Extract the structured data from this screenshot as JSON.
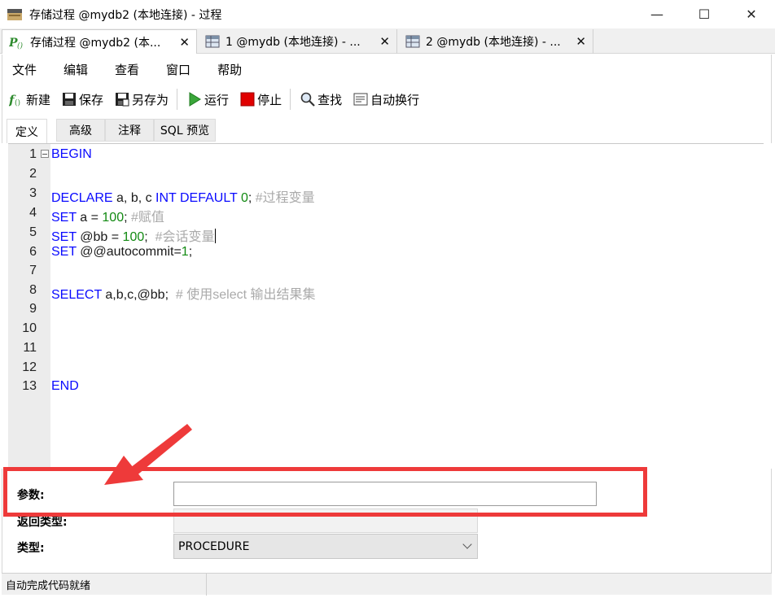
{
  "window": {
    "title": "存储过程 @mydb2 (本地连接) - 过程",
    "minimize": "—",
    "maximize": "☐",
    "close": "✕"
  },
  "tabs": [
    {
      "label": "存储过程 @mydb2 (本...",
      "close": "✕",
      "active": true
    },
    {
      "label": "1 @mydb (本地连接) - ...",
      "close": "✕",
      "active": false
    },
    {
      "label": "2 @mydb (本地连接) - ...",
      "close": "✕",
      "active": false
    }
  ],
  "menu": [
    "文件",
    "编辑",
    "查看",
    "窗口",
    "帮助"
  ],
  "toolbar": {
    "new": "新建",
    "save": "保存",
    "save_as": "另存为",
    "run": "运行",
    "stop": "停止",
    "find": "查找",
    "word_wrap": "自动换行"
  },
  "subtabs": [
    "定义",
    "高级",
    "注释",
    "SQL 预览"
  ],
  "editor": {
    "line_numbers": [
      "1",
      "2",
      "3",
      "4",
      "5",
      "6",
      "7",
      "8",
      "9",
      "10",
      "11",
      "12",
      "13"
    ],
    "lines": {
      "l1_kw": "BEGIN",
      "l3_kw1": "DECLARE",
      "l3_txt1": " a, b, c ",
      "l3_kw2": "INT DEFAULT",
      "l3_txt2": " ",
      "l3_num": "0",
      "l3_txt3": ";",
      "l3_cmt": " #过程变量",
      "l4_kw": "SET",
      "l4_txt1": " a = ",
      "l4_num": "100",
      "l4_txt2": ";",
      "l4_cmt": " #赋值",
      "l5_kw": "SET",
      "l5_txt1": " @bb = ",
      "l5_num": "100",
      "l5_txt2": ";",
      "l5_cmt": "  #会话变量",
      "l6_kw": "SET",
      "l6_txt1": " @@autocommit=",
      "l6_num": "1",
      "l6_txt2": ";",
      "l8_kw": "SELECT",
      "l8_txt1": " a,b,c,@bb;",
      "l8_cmt": "  # 使用select 输出结果集",
      "l13_kw": "END"
    }
  },
  "form": {
    "params_label": "参数:",
    "params_value": "",
    "return_type_label": "返回类型:",
    "type_label": "类型:",
    "type_value": "PROCEDURE"
  },
  "status": {
    "text": "自动完成代码就绪"
  },
  "colors": {
    "keyword": "#0a0aff",
    "number": "#128a12",
    "comment": "#aaaaaa",
    "annotation": "#ee3a3a"
  }
}
